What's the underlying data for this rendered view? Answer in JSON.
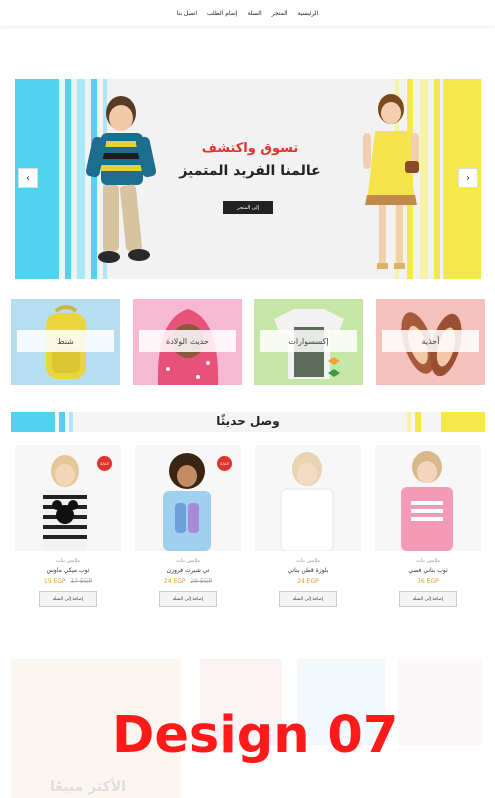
{
  "nav": {
    "items": [
      "الرئيسية",
      "المتجر",
      "السلة",
      "إتمام الطلب",
      "اتصل بنا"
    ]
  },
  "hero": {
    "headline": "تسوق واكتشف",
    "subheadline": "عالمنا الفريد المتميز",
    "cta_label": "إلى المتجر",
    "prev_arrow": "‹",
    "next_arrow": "›"
  },
  "categories": [
    {
      "label": "شنط",
      "icon": "backpack-icon",
      "bg": "#b6ddf0"
    },
    {
      "label": "حديث الولادة",
      "icon": "baby-icon",
      "bg": "#f7b9d2"
    },
    {
      "label": "إكسسوارات",
      "icon": "clothes-icon",
      "bg": "#c6e6a5"
    },
    {
      "label": "أحذية",
      "icon": "shoes-icon",
      "bg": "#f4c1bd"
    }
  ],
  "section": {
    "title": "وصل حديثًا"
  },
  "products": [
    {
      "brand": "ملابس بنات",
      "name": "ثوب ميكي ماوس",
      "price": "15 EGP",
      "old_price": "17 EGP",
      "sale": "SALE",
      "button": "إضافة إلى السلة"
    },
    {
      "brand": "ملابس بنات",
      "name": "تي شيرت فروزن",
      "price": "24 EGP",
      "old_price": "26 EGP",
      "sale": "SALE",
      "button": "إضافة إلى السلة"
    },
    {
      "brand": "ملابس بنات",
      "name": "بلوزة قطن بناتي",
      "price": "24 EGP",
      "old_price": "",
      "sale": "",
      "button": "إضافة إلى السلة"
    },
    {
      "brand": "ملابس بنات",
      "name": "ثوب بناتي فضي",
      "price": "16 EGP",
      "old_price": "",
      "sale": "",
      "button": "إضافة إلى السلة"
    }
  ],
  "faded": {
    "heading": "الأكثر مبيعًا"
  },
  "watermark": "Design 07",
  "colors": {
    "accent_red": "#e0332c",
    "price_orange": "#e4a020",
    "stripe_cyan": "#4fd3ef",
    "stripe_yellow": "#f4e94a"
  }
}
